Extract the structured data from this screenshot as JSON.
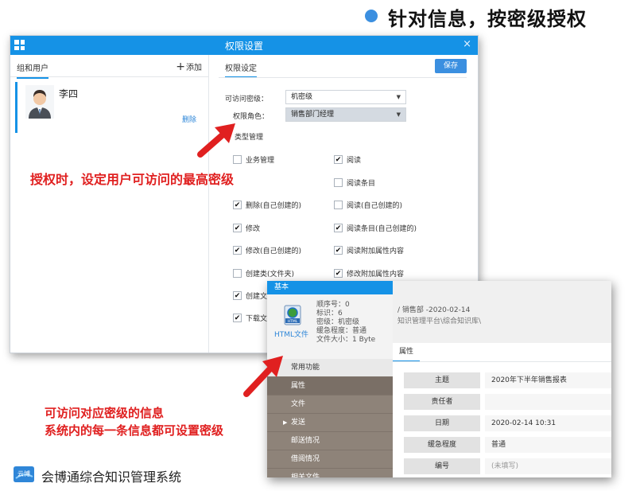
{
  "header": {
    "title": "针对信息，按密级授权",
    "dot_color": "#3b8fe0"
  },
  "perm_window": {
    "title": "权限设置",
    "close": "×",
    "left": {
      "tab_label": "组和用户",
      "add_label": "添加",
      "user": {
        "name": "李四",
        "delete_label": "删除"
      }
    },
    "right": {
      "tab_label": "权限设定",
      "save_label": "保存",
      "access_level_label": "可访问密级：",
      "access_level_value": "机密级",
      "role_label": "权限角色：",
      "role_value": "销售部门经理",
      "section_label": "类型管理",
      "permissions": [
        {
          "label": "业务管理",
          "checked": false
        },
        {
          "label": "阅读",
          "checked": true
        },
        {
          "label": "",
          "checked": false
        },
        {
          "label": "阅读条目",
          "checked": false
        },
        {
          "label": "删除(自己创建的)",
          "checked": true
        },
        {
          "label": "阅读(自己创建的)",
          "checked": false
        },
        {
          "label": "修改",
          "checked": true
        },
        {
          "label": "阅读条目(自己创建的)",
          "checked": true
        },
        {
          "label": "修改(自己创建的)",
          "checked": true
        },
        {
          "label": "阅读附加属性内容",
          "checked": true
        },
        {
          "label": "创建类(文件夹)",
          "checked": false
        },
        {
          "label": "修改附加属性内容",
          "checked": true
        },
        {
          "label": "创建文",
          "checked": true
        },
        {
          "label": "下载文",
          "checked": true
        }
      ]
    }
  },
  "annotations": {
    "top": "授权时，设定用户可访问的最高密级",
    "bottom_line1": "可访问对应密级的信息",
    "bottom_line2": "系统内的每一条信息都可设置密级",
    "color": "#e02020"
  },
  "info_window": {
    "panel_title": "基本",
    "file_label": "HTML文件",
    "file_icon_text": "HTML",
    "meta": [
      "顺序号：0",
      "标识：6",
      "密级：机密级",
      "缓急程度：普通",
      "文件大小：1 Byte"
    ],
    "menu": [
      "常用功能",
      "属性",
      "文件",
      "发送",
      "邮送情况",
      "借阅情况",
      "相关文件"
    ],
    "path_line1": "/ 销售部 -2020-02-14",
    "path_line2": "知识管理平台\\综合知识库\\",
    "tab_label": "属性",
    "properties": [
      {
        "label": "主题",
        "value": "2020年下半年销售报表"
      },
      {
        "label": "责任者",
        "value": ""
      },
      {
        "label": "日期",
        "value": "2020-02-14 10:31"
      },
      {
        "label": "缓急程度",
        "value": "普通"
      },
      {
        "label": "编号",
        "value": "(未填写)"
      }
    ]
  },
  "footer": {
    "logo_text": "云博",
    "system_name": "会博通综合知识管理系统"
  }
}
